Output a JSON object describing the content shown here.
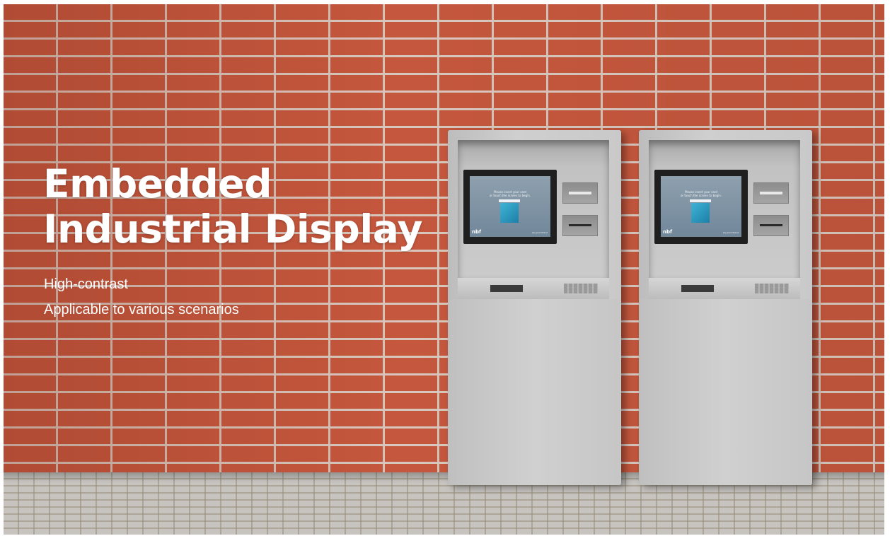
{
  "hero": {
    "title_line1": "Embedded",
    "title_line2": "Industrial Display",
    "features": [
      "High-contrast",
      "Applicable to various scenarios"
    ]
  },
  "kiosk_screen": {
    "message_line1": "Please insert your card",
    "message_line2": "or touch the screen to begin.",
    "logo": "nbf",
    "tagline": "be good friend"
  },
  "colors": {
    "brick": "#c4573d",
    "mortar": "#d8c7bd",
    "kiosk_body": "#c9c9c9",
    "text": "#ffffff"
  }
}
